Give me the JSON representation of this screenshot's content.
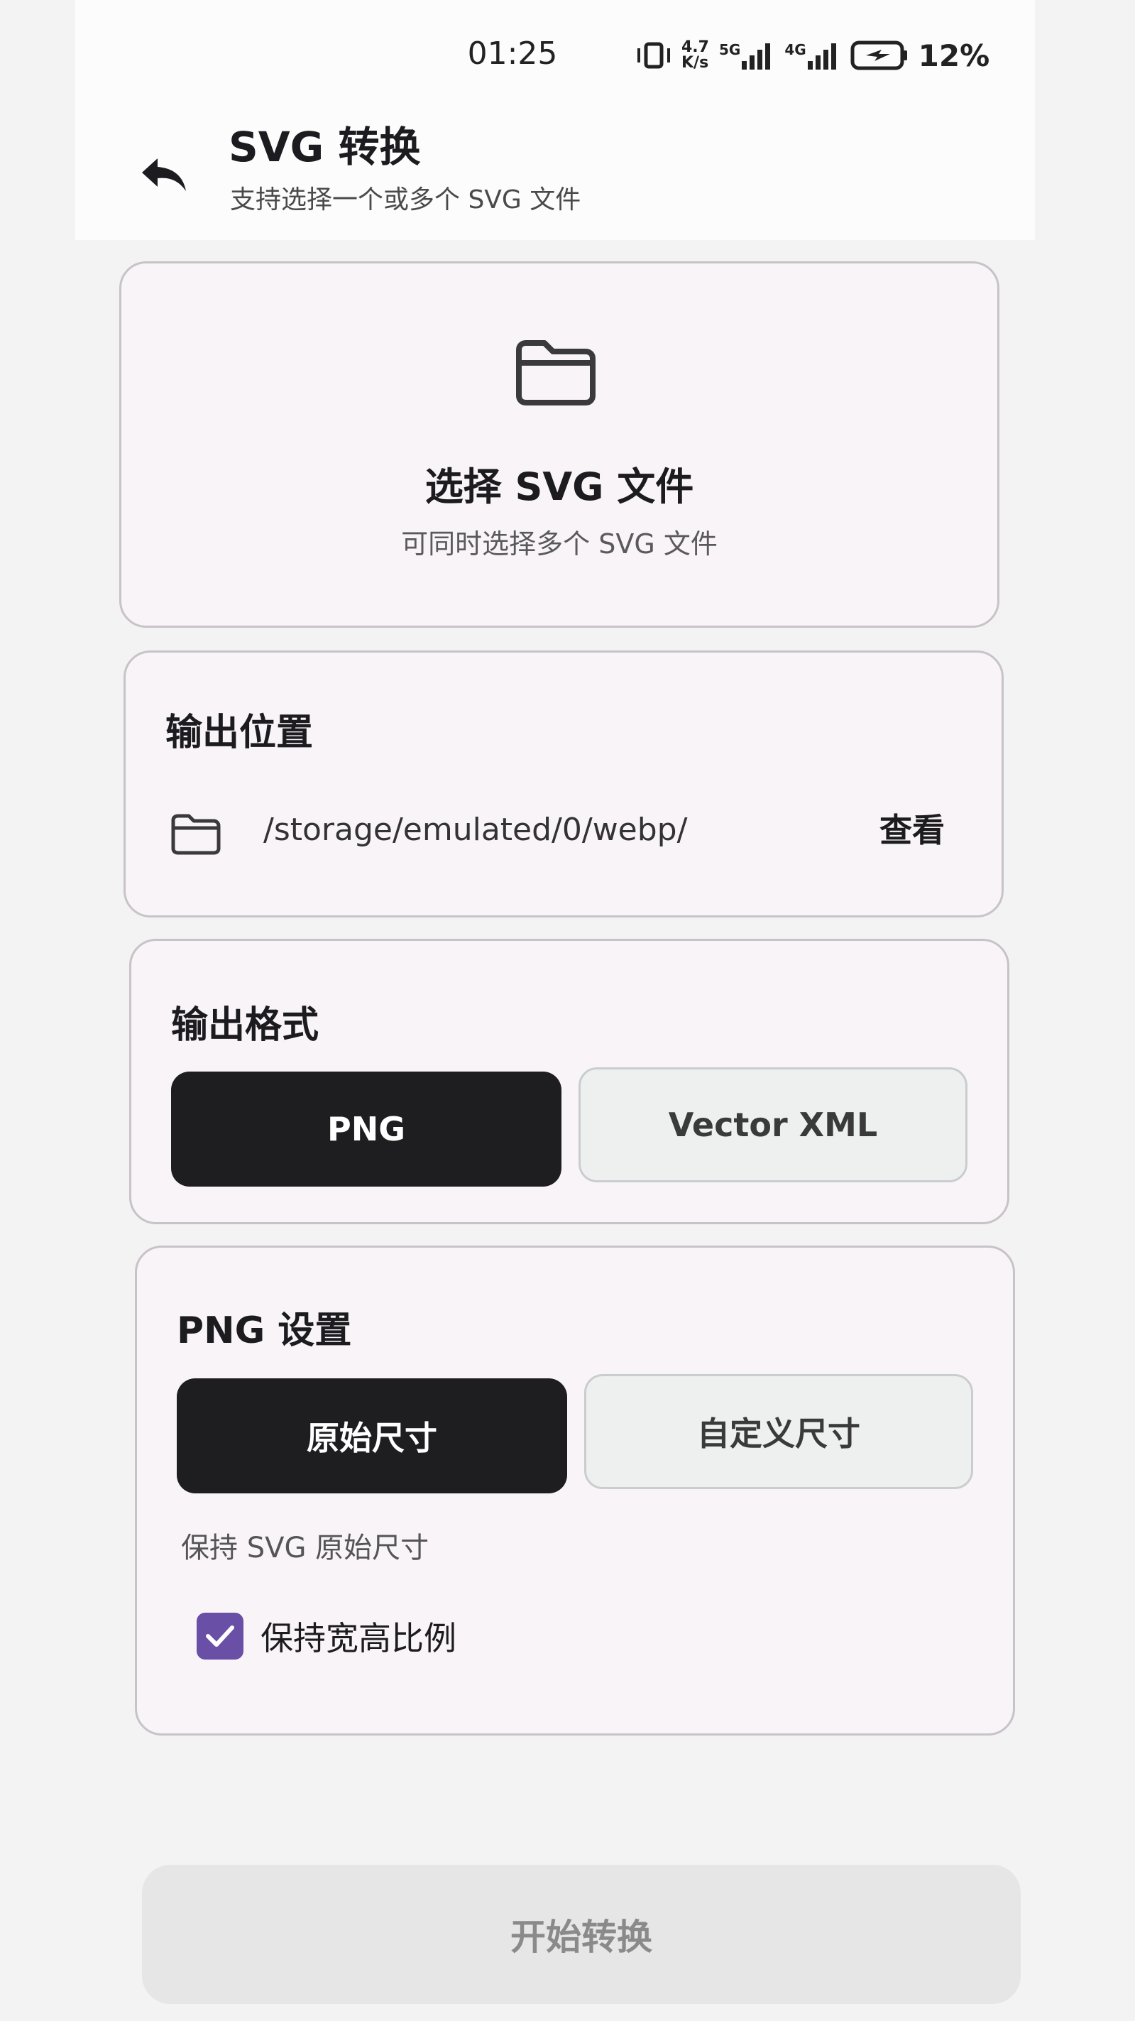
{
  "status_bar": {
    "time": "01:25",
    "net_speed_top": "4.7",
    "net_speed_bottom": "K/s",
    "network_5g": "5G",
    "network_4g": "4G",
    "battery": "12%"
  },
  "header": {
    "title": "SVG 转换",
    "subtitle": "支持选择一个或多个 SVG 文件",
    "back_icon": "back-arrow-icon"
  },
  "file_picker": {
    "icon": "folder-icon",
    "title": "选择 SVG 文件",
    "subtitle": "可同时选择多个 SVG 文件"
  },
  "output_location": {
    "title": "输出位置",
    "icon": "folder-icon",
    "path": "/storage/emulated/0/webp/",
    "view_label": "查看"
  },
  "output_format": {
    "title": "输出格式",
    "options": [
      "PNG",
      "Vector XML"
    ],
    "selected": "PNG"
  },
  "png_settings": {
    "title": "PNG 设置",
    "options": [
      "原始尺寸",
      "自定义尺寸"
    ],
    "selected": "原始尺寸",
    "hint": "保持 SVG 原始尺寸",
    "keep_ratio_label": "保持宽高比例",
    "keep_ratio_checked": true
  },
  "start_button": "开始转换",
  "colors": {
    "selected_button": "#1e1e20",
    "checkbox": "#6a4fa6",
    "card_bg": "#f9f4f8",
    "disabled_button": "#e6e6e6"
  }
}
